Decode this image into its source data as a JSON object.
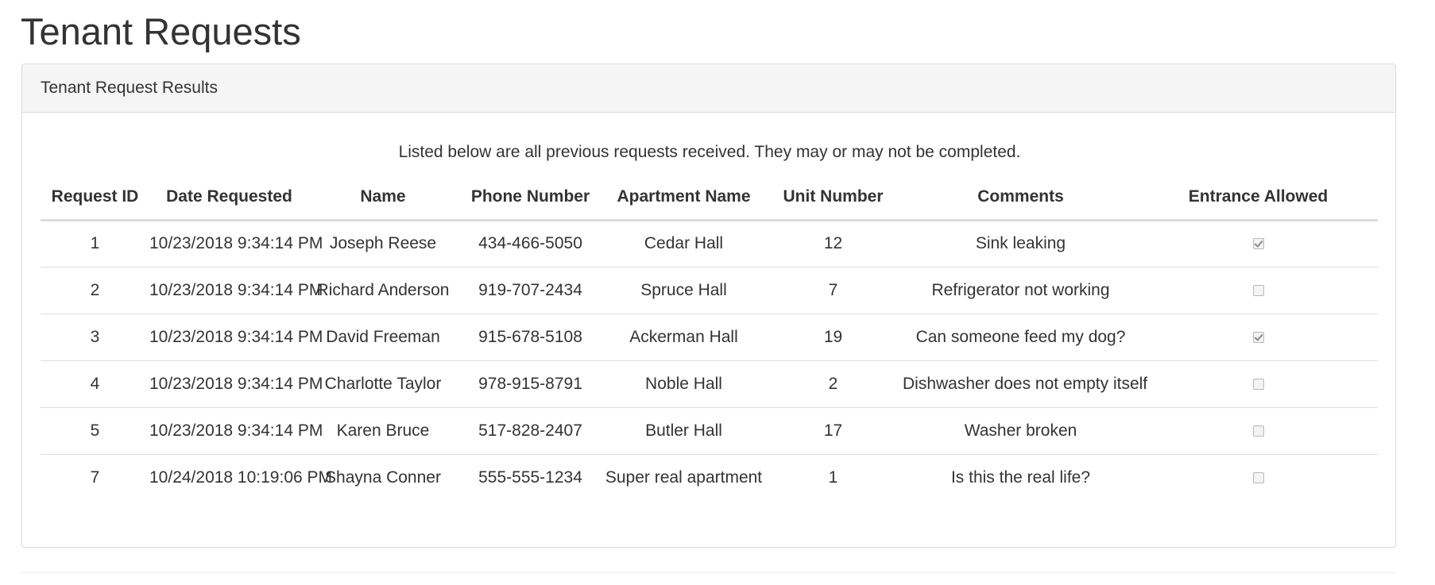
{
  "page": {
    "title": "Tenant Requests"
  },
  "panel": {
    "heading": "Tenant Request Results",
    "intro": "Listed below are all previous requests received. They may or may not be completed."
  },
  "table": {
    "columns": [
      "Request ID",
      "Date Requested",
      "Name",
      "Phone Number",
      "Apartment Name",
      "Unit Number",
      "Comments",
      "Entrance Allowed"
    ],
    "rows": [
      {
        "id": "1",
        "date": "10/23/2018 9:34:14 PM",
        "name": "Joseph Reese",
        "phone": "434-466-5050",
        "apartment": "Cedar Hall",
        "unit": "12",
        "comments": "Sink leaking",
        "entrance_allowed": true
      },
      {
        "id": "2",
        "date": "10/23/2018 9:34:14 PM",
        "name": "Richard Anderson",
        "phone": "919-707-2434",
        "apartment": "Spruce Hall",
        "unit": "7",
        "comments": "Refrigerator not working",
        "entrance_allowed": false
      },
      {
        "id": "3",
        "date": "10/23/2018 9:34:14 PM",
        "name": "David Freeman",
        "phone": "915-678-5108",
        "apartment": "Ackerman Hall",
        "unit": "19",
        "comments": "Can someone feed my dog?",
        "entrance_allowed": true
      },
      {
        "id": "4",
        "date": "10/23/2018 9:34:14 PM",
        "name": "Charlotte Taylor",
        "phone": "978-915-8791",
        "apartment": "Noble Hall",
        "unit": "2",
        "comments": "Dishwasher does not empty itself",
        "entrance_allowed": false
      },
      {
        "id": "5",
        "date": "10/23/2018 9:34:14 PM",
        "name": "Karen Bruce",
        "phone": "517-828-2407",
        "apartment": "Butler Hall",
        "unit": "17",
        "comments": "Washer broken",
        "entrance_allowed": false
      },
      {
        "id": "7",
        "date": "10/24/2018 10:19:06 PM",
        "name": "Shayna Conner",
        "phone": "555-555-1234",
        "apartment": "Super real apartment",
        "unit": "1",
        "comments": "Is this the real life?",
        "entrance_allowed": false
      }
    ]
  }
}
